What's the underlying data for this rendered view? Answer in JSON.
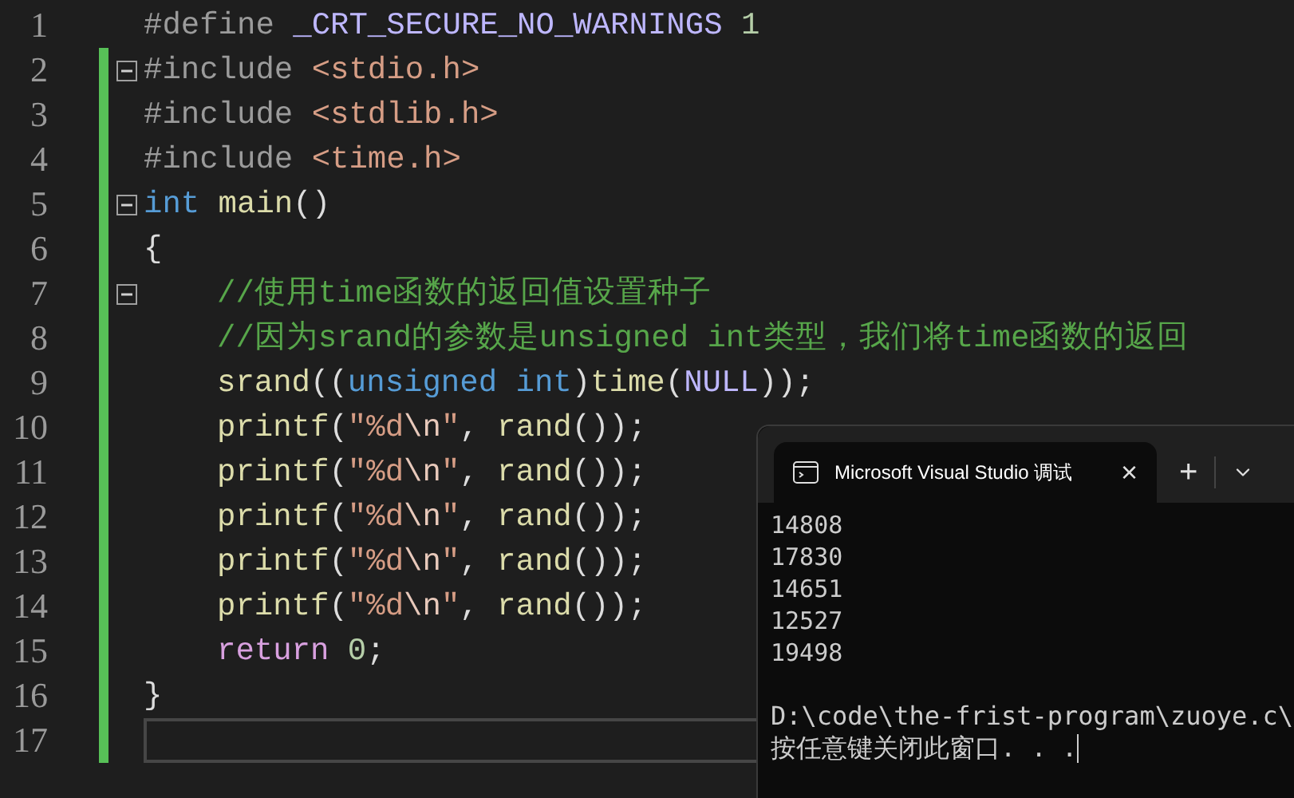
{
  "editor": {
    "lines": [
      {
        "number": "1",
        "changed": false,
        "fold": false,
        "indented": false,
        "current": false,
        "tokens": [
          {
            "text": "#define ",
            "kind": "preproc"
          },
          {
            "text": "_CRT_SECURE_NO_WARNINGS",
            "kind": "macro"
          },
          {
            "text": " 1",
            "kind": "number"
          }
        ]
      },
      {
        "number": "2",
        "changed": true,
        "fold": true,
        "indented": false,
        "current": false,
        "tokens": [
          {
            "text": "#include ",
            "kind": "preproc"
          },
          {
            "text": "<stdio.h>",
            "kind": "string"
          }
        ]
      },
      {
        "number": "3",
        "changed": true,
        "fold": false,
        "indented": false,
        "current": false,
        "tokens": [
          {
            "text": "#include ",
            "kind": "preproc"
          },
          {
            "text": "<stdlib.h>",
            "kind": "string"
          }
        ]
      },
      {
        "number": "4",
        "changed": true,
        "fold": false,
        "indented": false,
        "current": false,
        "tokens": [
          {
            "text": "#include ",
            "kind": "preproc"
          },
          {
            "text": "<time.h>",
            "kind": "string"
          }
        ]
      },
      {
        "number": "5",
        "changed": true,
        "fold": true,
        "indented": false,
        "current": false,
        "tokens": [
          {
            "text": "int",
            "kind": "keyword"
          },
          {
            "text": " main",
            "kind": "function"
          },
          {
            "text": "()",
            "kind": "plain"
          }
        ]
      },
      {
        "number": "6",
        "changed": true,
        "fold": false,
        "indented": false,
        "current": false,
        "tokens": [
          {
            "text": "{",
            "kind": "plain"
          }
        ]
      },
      {
        "number": "7",
        "changed": true,
        "fold": true,
        "indented": true,
        "current": false,
        "tokens": [
          {
            "text": "//使用time函数的返回值设置种子",
            "kind": "comment"
          }
        ]
      },
      {
        "number": "8",
        "changed": true,
        "fold": false,
        "indented": true,
        "current": false,
        "tokens": [
          {
            "text": "//因为srand的参数是unsigned int类型，我们将time函数的返回",
            "kind": "comment"
          }
        ]
      },
      {
        "number": "9",
        "changed": true,
        "fold": false,
        "indented": true,
        "current": false,
        "tokens": [
          {
            "text": "srand",
            "kind": "function"
          },
          {
            "text": "((",
            "kind": "plain"
          },
          {
            "text": "unsigned int",
            "kind": "keyword"
          },
          {
            "text": ")",
            "kind": "plain"
          },
          {
            "text": "time",
            "kind": "function"
          },
          {
            "text": "(",
            "kind": "plain"
          },
          {
            "text": "NULL",
            "kind": "macro"
          },
          {
            "text": "));",
            "kind": "plain"
          }
        ]
      },
      {
        "number": "10",
        "changed": true,
        "fold": false,
        "indented": true,
        "current": false,
        "tokens": [
          {
            "text": "printf",
            "kind": "function"
          },
          {
            "text": "(",
            "kind": "plain"
          },
          {
            "text": "\"%d",
            "kind": "string"
          },
          {
            "text": "\\n",
            "kind": "escape"
          },
          {
            "text": "\"",
            "kind": "string"
          },
          {
            "text": ", ",
            "kind": "plain"
          },
          {
            "text": "rand",
            "kind": "function"
          },
          {
            "text": "());",
            "kind": "plain"
          }
        ]
      },
      {
        "number": "11",
        "changed": true,
        "fold": false,
        "indented": true,
        "current": false,
        "tokens": [
          {
            "text": "printf",
            "kind": "function"
          },
          {
            "text": "(",
            "kind": "plain"
          },
          {
            "text": "\"%d",
            "kind": "string"
          },
          {
            "text": "\\n",
            "kind": "escape"
          },
          {
            "text": "\"",
            "kind": "string"
          },
          {
            "text": ", ",
            "kind": "plain"
          },
          {
            "text": "rand",
            "kind": "function"
          },
          {
            "text": "());",
            "kind": "plain"
          }
        ]
      },
      {
        "number": "12",
        "changed": true,
        "fold": false,
        "indented": true,
        "current": false,
        "tokens": [
          {
            "text": "printf",
            "kind": "function"
          },
          {
            "text": "(",
            "kind": "plain"
          },
          {
            "text": "\"%d",
            "kind": "string"
          },
          {
            "text": "\\n",
            "kind": "escape"
          },
          {
            "text": "\"",
            "kind": "string"
          },
          {
            "text": ", ",
            "kind": "plain"
          },
          {
            "text": "rand",
            "kind": "function"
          },
          {
            "text": "());",
            "kind": "plain"
          }
        ]
      },
      {
        "number": "13",
        "changed": true,
        "fold": false,
        "indented": true,
        "current": false,
        "tokens": [
          {
            "text": "printf",
            "kind": "function"
          },
          {
            "text": "(",
            "kind": "plain"
          },
          {
            "text": "\"%d",
            "kind": "string"
          },
          {
            "text": "\\n",
            "kind": "escape"
          },
          {
            "text": "\"",
            "kind": "string"
          },
          {
            "text": ", ",
            "kind": "plain"
          },
          {
            "text": "rand",
            "kind": "function"
          },
          {
            "text": "());",
            "kind": "plain"
          }
        ]
      },
      {
        "number": "14",
        "changed": true,
        "fold": false,
        "indented": true,
        "current": false,
        "tokens": [
          {
            "text": "printf",
            "kind": "function"
          },
          {
            "text": "(",
            "kind": "plain"
          },
          {
            "text": "\"%d",
            "kind": "string"
          },
          {
            "text": "\\n",
            "kind": "escape"
          },
          {
            "text": "\"",
            "kind": "string"
          },
          {
            "text": ", ",
            "kind": "plain"
          },
          {
            "text": "rand",
            "kind": "function"
          },
          {
            "text": "());",
            "kind": "plain"
          }
        ]
      },
      {
        "number": "15",
        "changed": true,
        "fold": false,
        "indented": true,
        "current": false,
        "tokens": [
          {
            "text": "return",
            "kind": "control"
          },
          {
            "text": " 0",
            "kind": "number"
          },
          {
            "text": ";",
            "kind": "plain"
          }
        ]
      },
      {
        "number": "16",
        "changed": true,
        "fold": false,
        "indented": false,
        "current": false,
        "tokens": [
          {
            "text": "}",
            "kind": "plain"
          }
        ]
      },
      {
        "number": "17",
        "changed": true,
        "fold": false,
        "current": true
      }
    ]
  },
  "terminal": {
    "tab": {
      "title": "Microsoft Visual Studio 调试",
      "close": "×"
    },
    "new_tab": "+",
    "output": [
      "14808",
      "17830",
      "14651",
      "12527",
      "19498"
    ],
    "path": "D:\\code\\the-frist-program\\zuoye.c\\",
    "prompt": "按任意键关闭此窗口. . ."
  }
}
